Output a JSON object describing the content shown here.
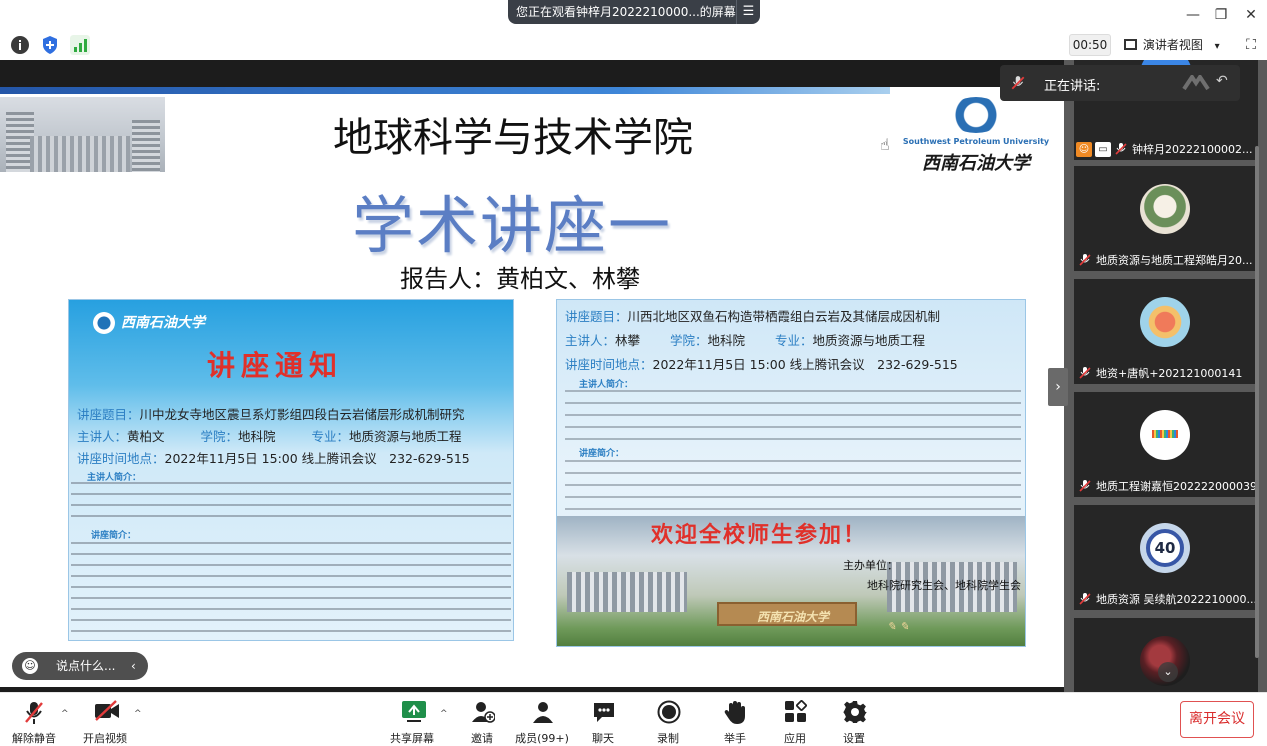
{
  "titlebar": {
    "viewing_banner": "您正在观看钟梓月2022210000...的屏幕",
    "minimize_icon": "minimize-icon",
    "restore_icon": "restore-icon",
    "close_icon": "close-icon"
  },
  "statusbar": {
    "icons": [
      "info-icon",
      "shield-icon",
      "signal-icon"
    ],
    "timer": "00:50",
    "view_mode": "演讲者视图",
    "view_mode_caret": "▾"
  },
  "slide": {
    "title": "地球科学与技术学院",
    "university_en": "Southwest Petroleum University",
    "university_cn": "西南石油大学",
    "series_title": "学术讲座一",
    "speakers": "报告人：黄柏文、林攀"
  },
  "poster_left": {
    "logo_text": "西南石油大学",
    "notice_title": "讲座通知",
    "topic_label": "讲座题目：",
    "topic": "川中龙女寺地区震旦系灯影组四段白云岩储层形成机制研究",
    "host_label": "主讲人：",
    "host": "黄柏文",
    "college_label": "学院：",
    "college": "地科院",
    "major_label": "专业：",
    "major": "地质资源与地质工程",
    "time_label": "讲座时间地点：",
    "time_place": "2022年11月5日 15:00 线上腾讯会议　232-629-515",
    "host_intro_head": "主讲人简介：",
    "lecture_intro_head": "讲座简介："
  },
  "poster_right": {
    "topic_label": "讲座题目：",
    "topic": "川西北地区双鱼石构造带栖霞组白云岩及其储层成因机制",
    "host_label": "主讲人：",
    "host": "林攀",
    "college_label": "学院：",
    "college": "地科院",
    "major_label": "专业：",
    "major": "地质资源与地质工程",
    "time_label": "讲座时间地点：",
    "time_place": "2022年11月5日 15:00 线上腾讯会议　232-629-515",
    "host_intro_head": "主讲人简介：",
    "lecture_intro_head": "讲座简介：",
    "welcome": "欢迎全校师生参加！",
    "organizer_head": "主办单位：",
    "organizer": "地科院研究生会、地科院学生会",
    "gate_text": "西南石油大学"
  },
  "chat": {
    "placeholder": "说点什么...",
    "arrow": "‹"
  },
  "speaking": {
    "label": "正在讲话:"
  },
  "participants": [
    {
      "name": "钟梓月20222100002...",
      "avatar_color": "#3b86e6",
      "avatar_text": ""
    },
    {
      "name": "地质资源与地质工程郑皓月20...",
      "avatar_color": "#e9e2d4",
      "avatar_text": ""
    },
    {
      "name": "地资+唐帆+202121000141",
      "avatar_color": "#9fd3ea",
      "avatar_text": ""
    },
    {
      "name": "地质工程谢嘉恒202222000039",
      "avatar_color": "#ffffff",
      "avatar_text": ""
    },
    {
      "name": "地质资源 吴续航2022210000...",
      "avatar_color": "#c5d6ea",
      "avatar_text": "40"
    },
    {
      "name": "",
      "avatar_color": "#5a1f24",
      "avatar_text": ""
    }
  ],
  "toolbar": {
    "mute": "解除静音",
    "video": "开启视频",
    "share": "共享屏幕",
    "invite": "邀请",
    "members": "成员(99+)",
    "chat": "聊天",
    "record": "录制",
    "raise_hand": "举手",
    "apps": "应用",
    "settings": "设置",
    "leave": "离开会议",
    "caret": "^"
  },
  "colors": {
    "leave_red": "#d92d2d",
    "brand_blue": "#2c7fc3",
    "notice_red": "#e0302a",
    "sidebar_bg": "#5a5a5a"
  }
}
